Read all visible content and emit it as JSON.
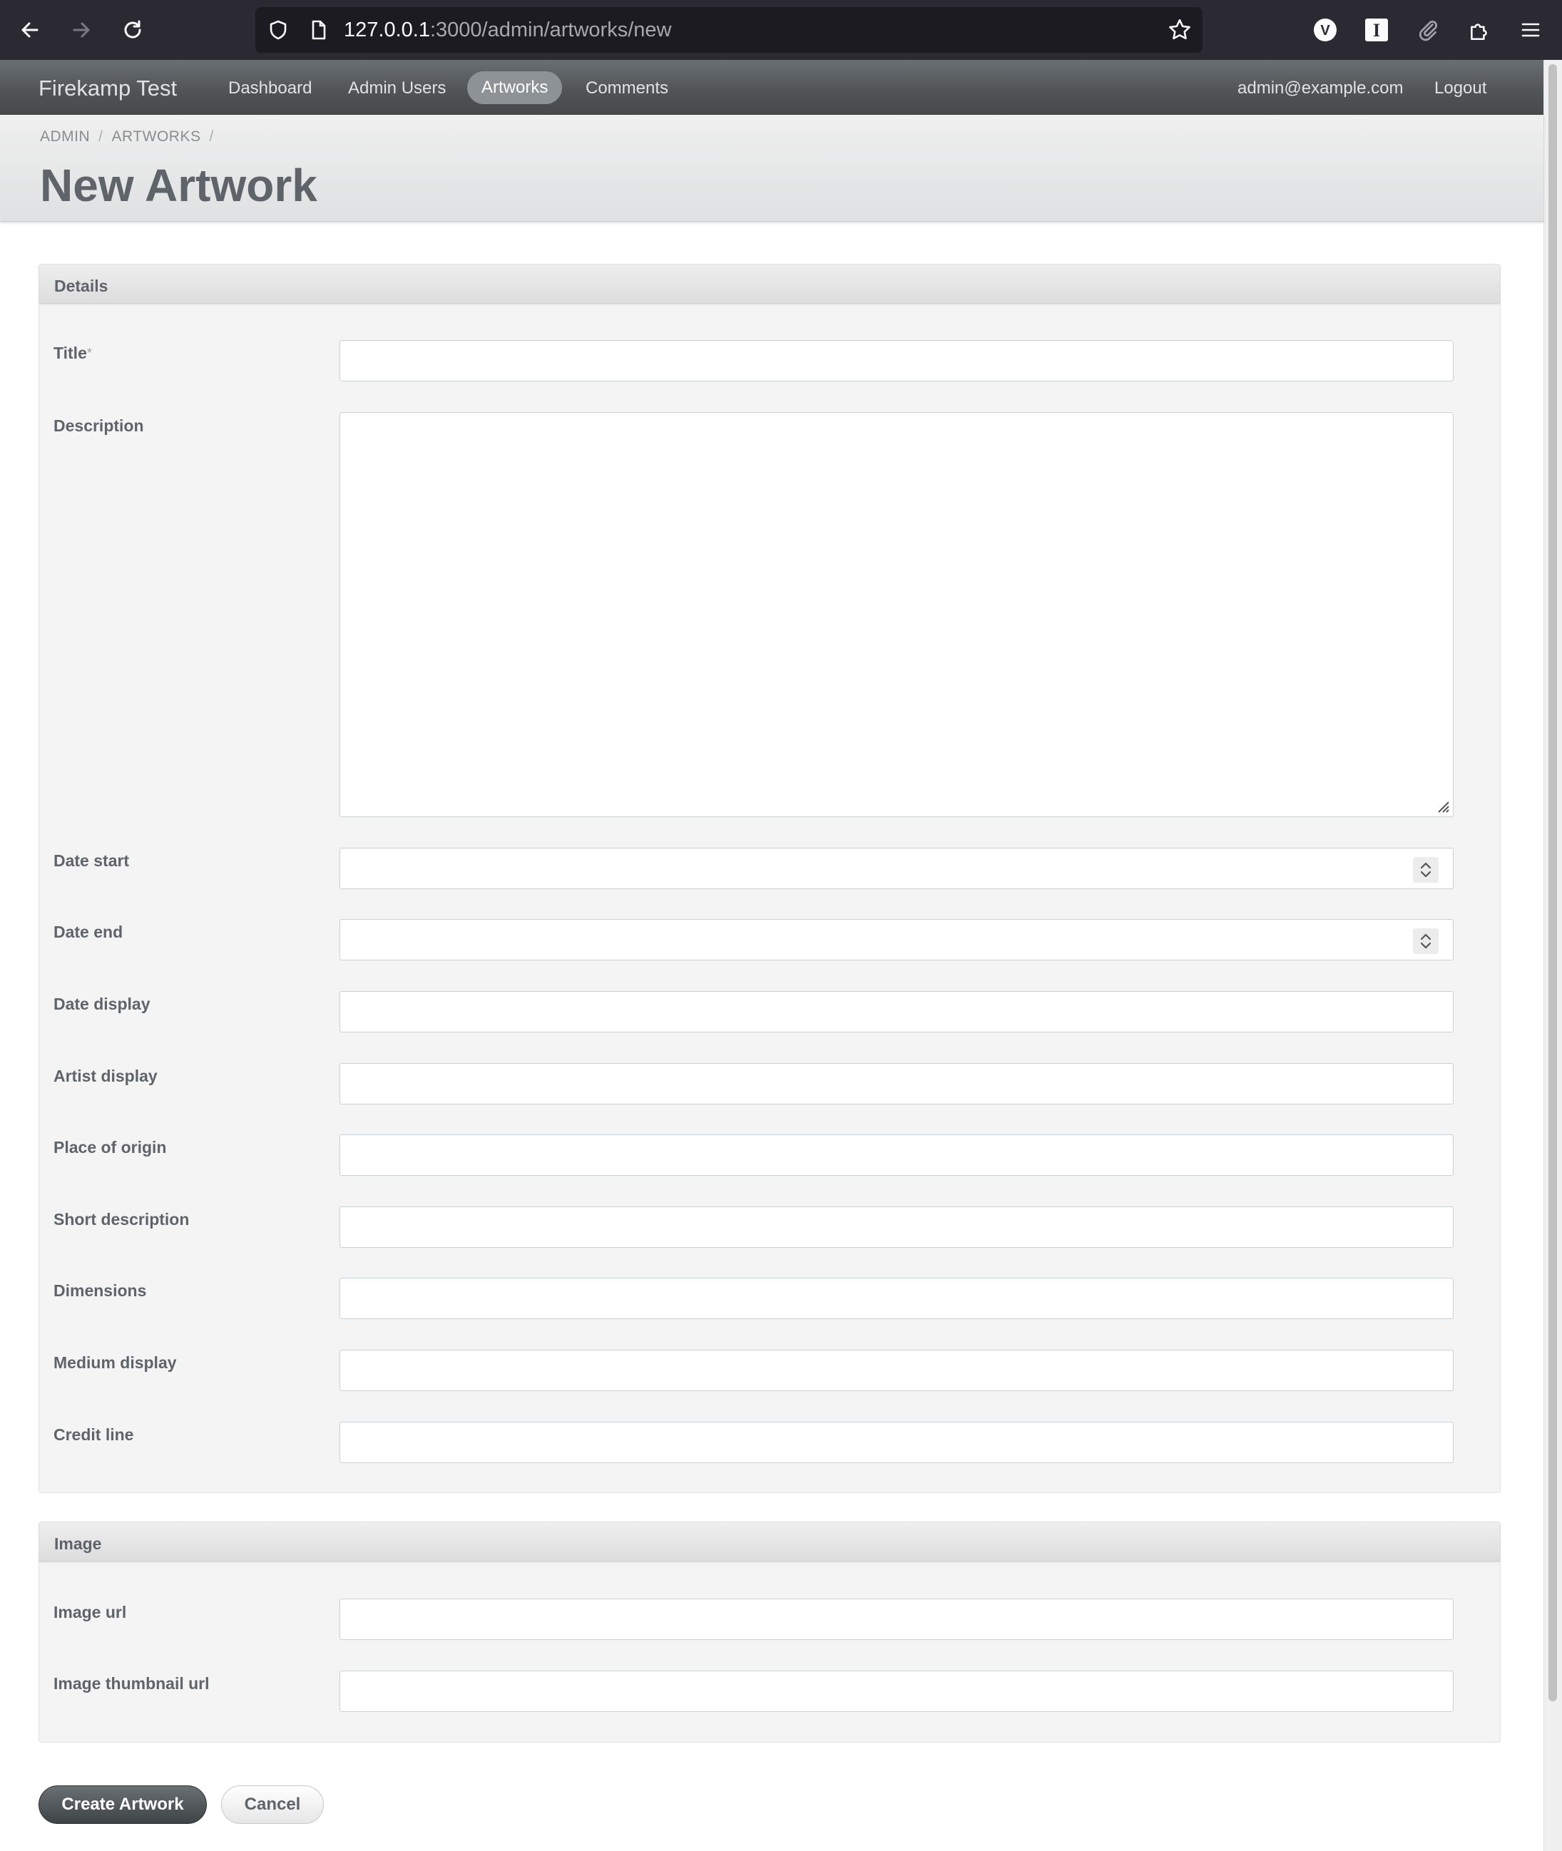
{
  "browser": {
    "url_host": "127.0.0.1",
    "url_rest": ":3000/admin/artworks/new"
  },
  "header": {
    "site_title": "Firekamp Test",
    "nav": [
      {
        "label": "Dashboard",
        "active": false
      },
      {
        "label": "Admin Users",
        "active": false
      },
      {
        "label": "Artworks",
        "active": true
      },
      {
        "label": "Comments",
        "active": false
      }
    ],
    "user_email": "admin@example.com",
    "logout_label": "Logout"
  },
  "title_bar": {
    "breadcrumb": [
      "ADMIN",
      "ARTWORKS"
    ],
    "breadcrumb_sep": "/",
    "page_title": "New Artwork"
  },
  "details_panel": {
    "title": "Details",
    "required_marker": "*",
    "fields": [
      {
        "label": "Title",
        "value": "",
        "required": true,
        "type": "text"
      },
      {
        "label": "Description",
        "value": "",
        "type": "textarea"
      },
      {
        "label": "Date start",
        "value": "",
        "type": "number"
      },
      {
        "label": "Date end",
        "value": "",
        "type": "number"
      },
      {
        "label": "Date display",
        "value": "",
        "type": "text"
      },
      {
        "label": "Artist display",
        "value": "",
        "type": "text"
      },
      {
        "label": "Place of origin",
        "value": "",
        "type": "text"
      },
      {
        "label": "Short description",
        "value": "",
        "type": "text"
      },
      {
        "label": "Dimensions",
        "value": "",
        "type": "text"
      },
      {
        "label": "Medium display",
        "value": "",
        "type": "text"
      },
      {
        "label": "Credit line",
        "value": "",
        "type": "text"
      }
    ]
  },
  "image_panel": {
    "title": "Image",
    "fields": [
      {
        "label": "Image url",
        "value": "",
        "type": "text"
      },
      {
        "label": "Image thumbnail url",
        "value": "",
        "type": "text"
      }
    ]
  },
  "actions": {
    "submit_label": "Create Artwork",
    "cancel_label": "Cancel"
  },
  "colors": {
    "header_bg": "#4f5356",
    "panel_bg": "#f4f4f4",
    "primary_button": "#3e4346"
  }
}
